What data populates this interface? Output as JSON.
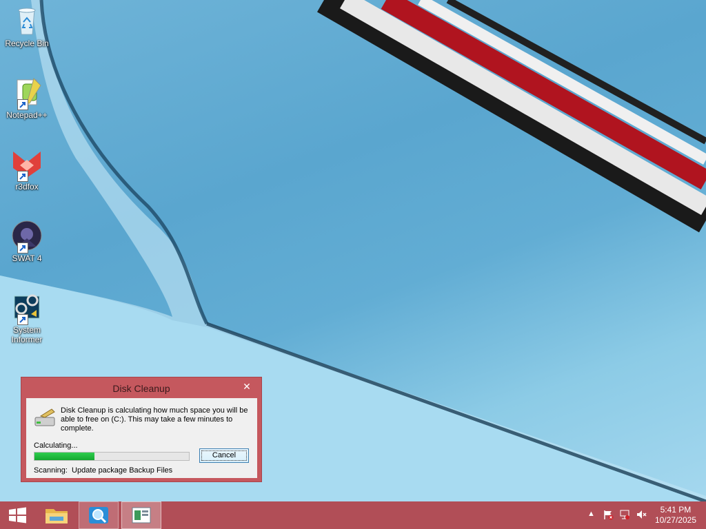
{
  "desktop": {
    "icons": [
      {
        "label": "Recycle Bin"
      },
      {
        "label": "Notepad++"
      },
      {
        "label": "r3dfox"
      },
      {
        "label": "SWAT 4"
      },
      {
        "label": "System\nInformer"
      }
    ]
  },
  "dialog": {
    "title": "Disk Cleanup",
    "message": "Disk Cleanup is calculating how much space you will be able to free on  (C:). This may take a few minutes to complete.",
    "status": "Calculating...",
    "progress_fraction": 0.39,
    "cancel_label": "Cancel",
    "scanning": "Scanning:  Update package Backup Files"
  },
  "taskbar": {
    "time": "5:41 PM",
    "date": "10/27/2025",
    "accent": "#b14e57"
  }
}
